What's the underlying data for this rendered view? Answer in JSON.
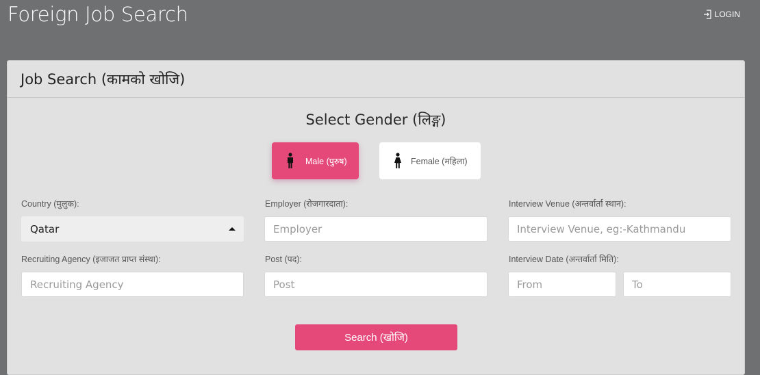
{
  "header": {
    "app_title": "Foreign Job Search",
    "login_label": "LOGIN",
    "login_icon": "sign-in-icon"
  },
  "card": {
    "title": "Job Search (कामको खोजि)"
  },
  "gender": {
    "title": "Select Gender (लिङ्ग)",
    "options": [
      {
        "label": "Male (पुरुष)",
        "icon": "male-icon",
        "selected": true
      },
      {
        "label": "Female (महिला)",
        "icon": "female-icon",
        "selected": false
      }
    ]
  },
  "form": {
    "country": {
      "label": "Country (मुलुक):",
      "value": "Qatar"
    },
    "employer": {
      "label": "Employer (रोजगारदाता):",
      "placeholder": "Employer",
      "value": ""
    },
    "venue": {
      "label": "Interview Venue (अन्तर्वार्ता स्थान):",
      "placeholder": "Interview Venue, eg:-Kathmandu",
      "value": ""
    },
    "agency": {
      "label": "Recruiting Agency (इजाजत प्राप्त संस्था):",
      "placeholder": "Recruiting Agency",
      "value": ""
    },
    "post": {
      "label": "Post (पद):",
      "placeholder": "Post",
      "value": ""
    },
    "date": {
      "label": "Interview Date (अन्तर्वार्ता मिति):",
      "from_placeholder": "From",
      "to_placeholder": "To"
    }
  },
  "search_button": "Search (खोजि)",
  "colors": {
    "accent": "#e4497a",
    "background": "#6f7072",
    "card": "#e1e1e1"
  }
}
